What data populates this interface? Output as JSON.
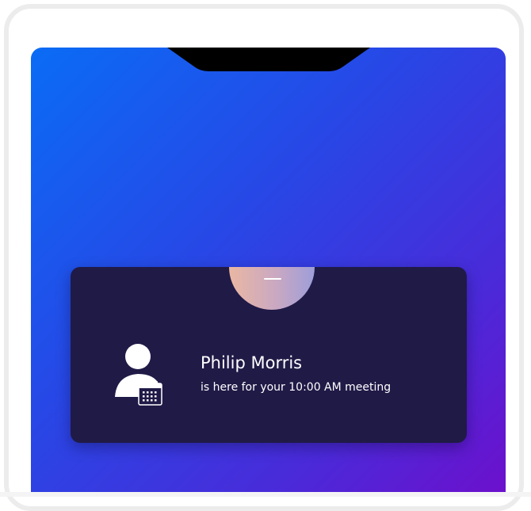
{
  "notification": {
    "visitor_name": "Philip Morris",
    "message": "is here for your 10:00 AM meeting"
  },
  "colors": {
    "screen_gradient_start": "#0a6cf5",
    "screen_gradient_end": "#6d10cc",
    "card_background": "#201a47",
    "avatar_gradient_start": "#e9b7a2",
    "avatar_gradient_end": "#9d9ed9"
  },
  "icons": {
    "visitor": "person-calendar-icon",
    "avatar": "avatar"
  }
}
